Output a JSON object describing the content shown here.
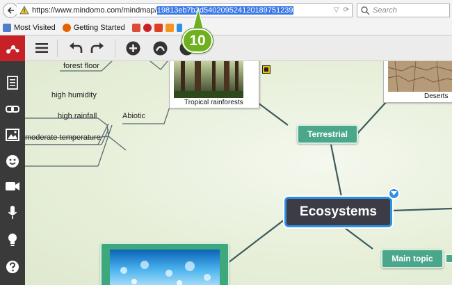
{
  "browser": {
    "url_prefix": "https://www.mindomo.com/mindmap/",
    "url_selected": "19813eb7b2d540209524120189751239",
    "search_placeholder": "Search",
    "bookmarks": [
      {
        "label": "Most Visited",
        "icon": "bookmark-folder-icon",
        "color": "#4c7fc8"
      },
      {
        "label": "Getting Started",
        "icon": "firefox-icon",
        "color": "#e66000"
      }
    ],
    "extra_bookmark_icons": [
      {
        "icon": "google-plus-icon",
        "color": "#dd4b39"
      },
      {
        "icon": "pinterest-icon",
        "color": "#cb2027"
      },
      {
        "icon": "mindomo-icon",
        "color": "#e04020"
      },
      {
        "icon": "rss-icon",
        "color": "#f7941d"
      },
      {
        "icon": "download-icon",
        "color": "#2f8fe0"
      }
    ]
  },
  "step_badge": "10",
  "mindmap": {
    "central_topic": "Ecosystems",
    "terrestrial": "Terrestrial",
    "main_topic": "Main topic",
    "abiotic": "Abiotic",
    "forest_floor": "forest floor",
    "high_humidity": "high humidity",
    "high_rainfall": "high rainfall",
    "moderate_temperature": "moderate temperature",
    "tropical_caption": "Tropical rainforests",
    "deserts_caption": "Deserts"
  },
  "colors": {
    "accent_blue": "#2f8fe0",
    "node_green": "#4aa78a",
    "brand_red": "#c52127",
    "badge_green": "#6fb01e",
    "sidebar_dark": "#3a3a3a"
  }
}
